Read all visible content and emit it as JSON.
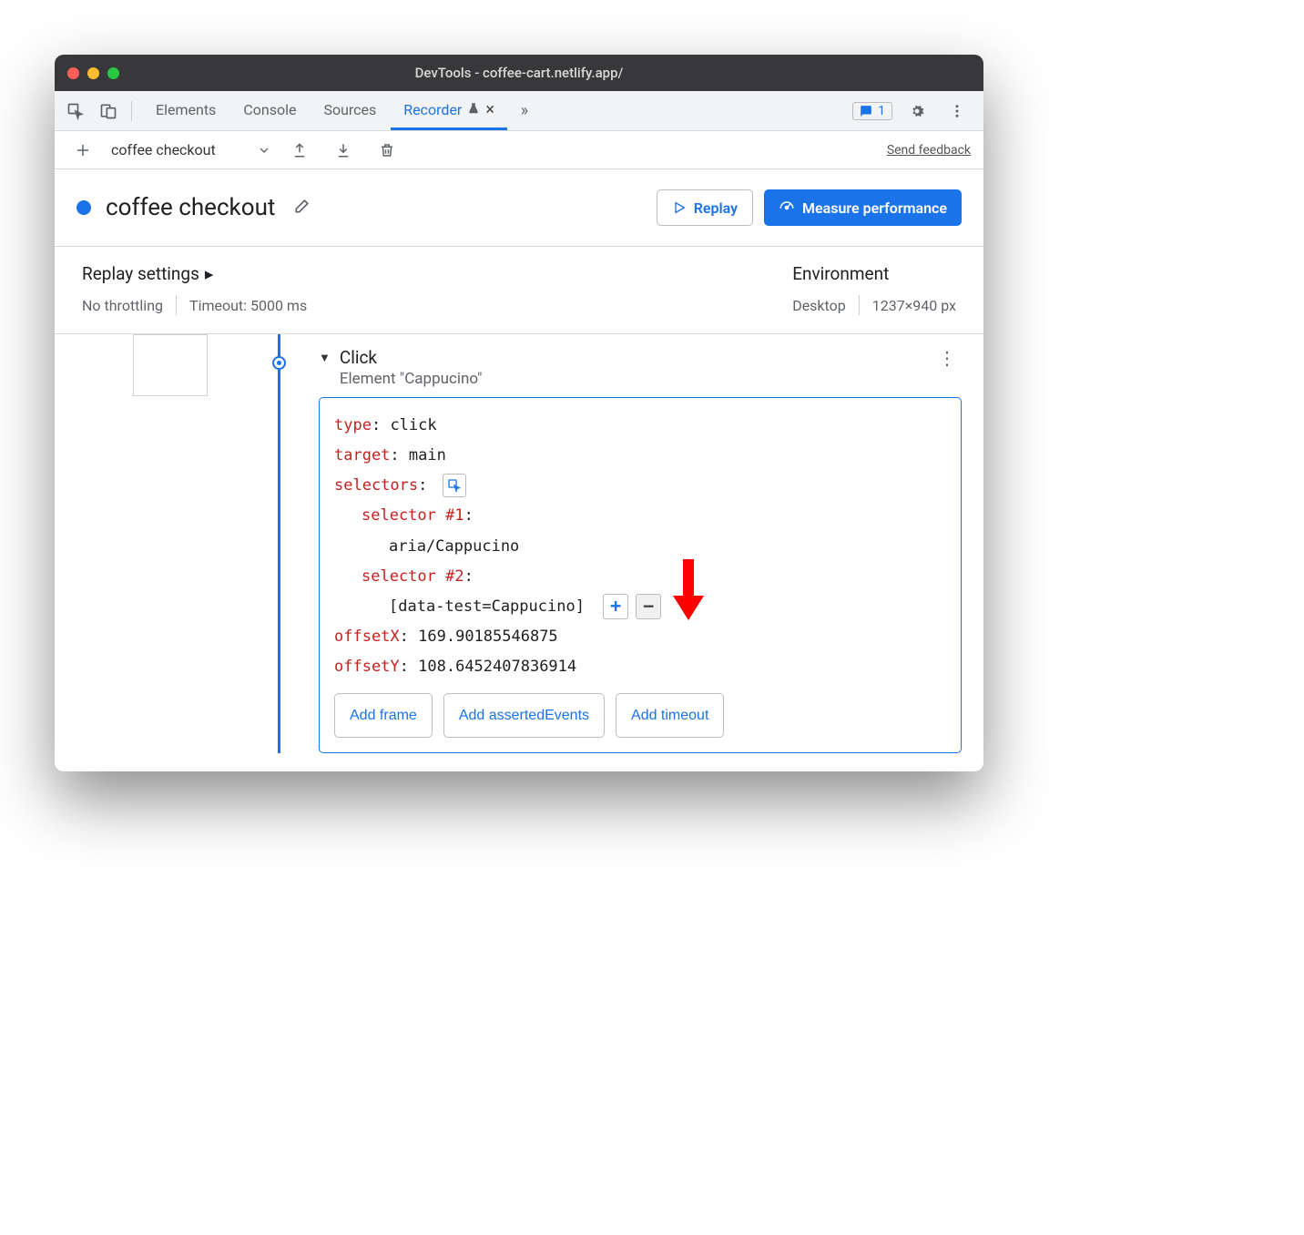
{
  "window": {
    "title": "DevTools - coffee-cart.netlify.app/"
  },
  "tabs": {
    "items": [
      "Elements",
      "Console",
      "Sources",
      "Recorder"
    ],
    "active": "Recorder",
    "issuesCount": "1"
  },
  "toolbar": {
    "recordingName": "coffee checkout",
    "sendFeedback": "Send feedback"
  },
  "header": {
    "title": "coffee checkout",
    "replay": "Replay",
    "measure": "Measure performance"
  },
  "settings": {
    "replayTitle": "Replay settings",
    "throttling": "No throttling",
    "timeout": "Timeout: 5000 ms",
    "envTitle": "Environment",
    "device": "Desktop",
    "viewport": "1237×940 px"
  },
  "step": {
    "title": "Click",
    "subtitle": "Element \"Cappucino\"",
    "props": {
      "typeKey": "type",
      "typeVal": "click",
      "targetKey": "target",
      "targetVal": "main",
      "selectorsKey": "selectors",
      "sel1Key": "selector #1",
      "sel1Val": "aria/Cappucino",
      "sel2Key": "selector #2",
      "sel2Val": "[data-test=Cappucino]",
      "offsetXKey": "offsetX",
      "offsetXVal": "169.90185546875",
      "offsetYKey": "offsetY",
      "offsetYVal": "108.6452407836914"
    },
    "actions": {
      "addFrame": "Add frame",
      "addAsserted": "Add assertedEvents",
      "addTimeout": "Add timeout"
    }
  }
}
